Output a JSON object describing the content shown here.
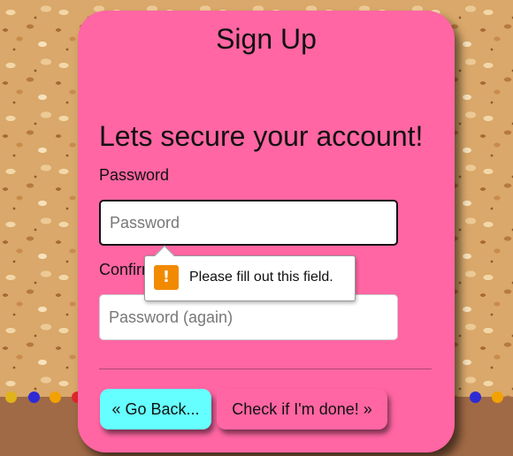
{
  "card": {
    "title": "Sign Up",
    "heading": "Lets secure your account!"
  },
  "form": {
    "password_label": "Password",
    "password_placeholder": "Password",
    "password_value": "",
    "confirm_label": "Confirm Password",
    "confirm_placeholder": "Password (again)",
    "confirm_value": ""
  },
  "validation_tooltip": {
    "icon": "warning-icon",
    "icon_glyph": "!",
    "message": "Please fill out this field."
  },
  "buttons": {
    "back_label": "« Go Back...",
    "check_label": "Check if I'm done! »"
  },
  "colors": {
    "card_background": "#ff66a3",
    "back_button": "#66ffff",
    "check_button": "#ff66a3",
    "warning_icon": "#f28a00",
    "shelf": "#a06a46"
  }
}
